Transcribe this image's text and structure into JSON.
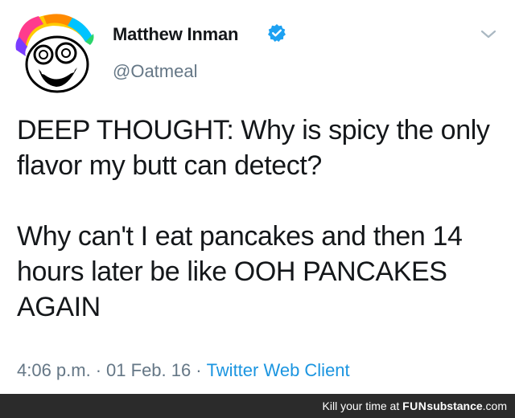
{
  "tweet": {
    "author_name": "Matthew Inman",
    "handle": "@Oatmeal",
    "paragraphs": [
      "DEEP THOUGHT: Why is spicy the only flavor my butt can detect?",
      "Why can't I eat pancakes and then 14 hours later be like OOH PANCAKES AGAIN"
    ],
    "time": "4:06 p.m.",
    "date": "01 Feb. 16",
    "source": "Twitter Web Client",
    "separator": "·"
  },
  "footer": {
    "tagline": "Kill your time at ",
    "brand_a": "FUN",
    "brand_b": "substance",
    "brand_c": ".com"
  },
  "icons": {
    "verified": "verified-badge-icon",
    "menu": "chevron-down-icon",
    "avatar": "oatmeal-avatar"
  },
  "colors": {
    "verified_blue": "#1da1f2",
    "link_blue": "#1b95e0",
    "muted_gray": "#657786",
    "text": "#14171a",
    "footer_bg": "#2b2b2b"
  }
}
